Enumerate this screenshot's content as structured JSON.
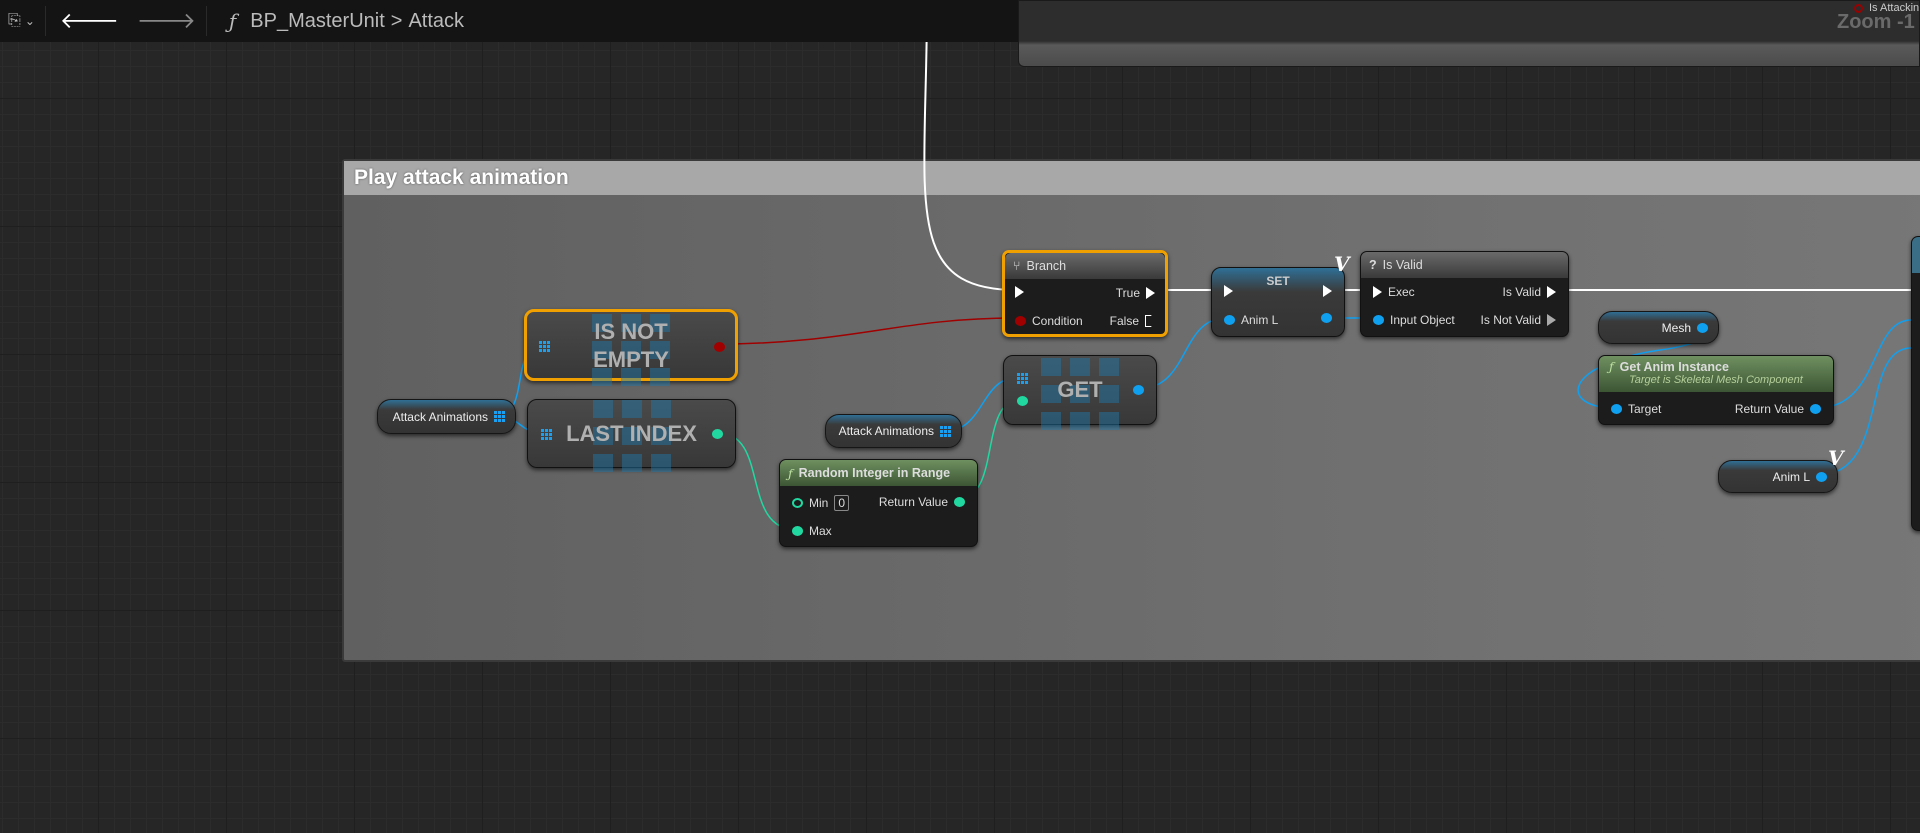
{
  "toolbar": {
    "bookmark_icon": "bookmark-icon",
    "back_icon": "arrow-left-icon",
    "forward_icon": "arrow-right-icon",
    "function_symbol": "ƒ",
    "blueprint": "BP_MasterUnit",
    "separator": ">",
    "function": "Attack"
  },
  "top_panel": {
    "pin_label": "Is Attackin",
    "zoom": "Zoom -1"
  },
  "comment": {
    "title": "Play attack animation"
  },
  "nodes": {
    "branch": {
      "title": "Branch",
      "true": "True",
      "condition": "Condition",
      "false": "False"
    },
    "set": {
      "title": "SET",
      "anim_l": "Anim L"
    },
    "is_valid": {
      "title": "Is Valid",
      "icon": "?",
      "exec": "Exec",
      "is_valid": "Is Valid",
      "input_object": "Input Object",
      "is_not_valid": "Is Not Valid"
    },
    "is_not_empty": {
      "line1": "IS NOT",
      "line2": "EMPTY"
    },
    "last_index": {
      "title": "LAST INDEX"
    },
    "get": {
      "title": "GET"
    },
    "random": {
      "title": "Random Integer in Range",
      "min": "Min",
      "min_value": "0",
      "max": "Max",
      "return": "Return Value"
    },
    "get_anim": {
      "title": "Get Anim Instance",
      "subtitle": "Target is Skeletal Mesh Component",
      "target": "Target",
      "return": "Return Value"
    }
  },
  "variables": {
    "attack_animations_1": "Attack Animations",
    "attack_animations_2": "Attack Animations",
    "mesh": "Mesh",
    "anim_l": "Anim L",
    "var_marker": "V"
  },
  "colors": {
    "exec": "#ffffff",
    "bool": "#a00000",
    "object": "#10a0f0",
    "int": "#20d8a0",
    "selected": "#f0a000"
  }
}
